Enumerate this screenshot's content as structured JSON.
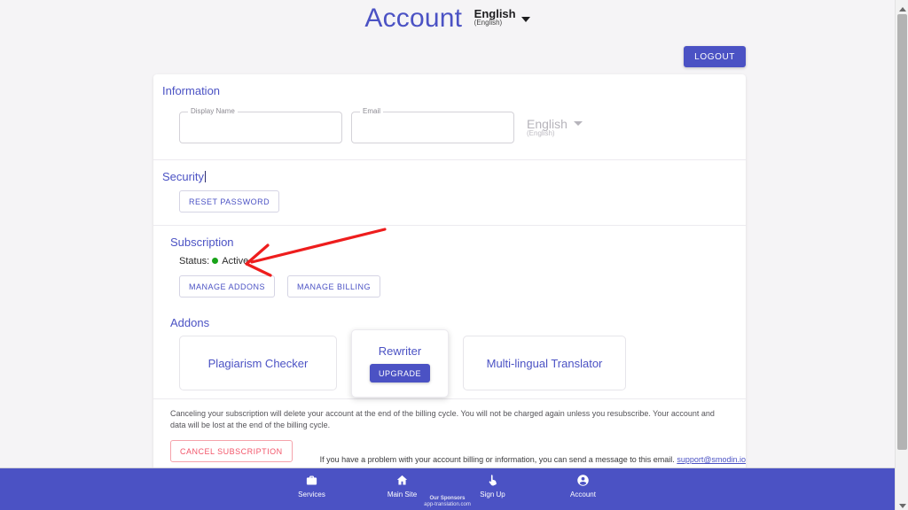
{
  "header": {
    "title": "Account",
    "language": {
      "name": "English",
      "native": "(English)"
    },
    "logout_label": "LOGOUT"
  },
  "information": {
    "section_title": "Information",
    "display_name": {
      "label": "Display Name",
      "value": ""
    },
    "email": {
      "label": "Email",
      "value": ""
    },
    "language": {
      "name": "English",
      "native": "(English)"
    }
  },
  "security": {
    "section_title": "Security",
    "reset_password_label": "RESET PASSWORD"
  },
  "subscription": {
    "section_title": "Subscription",
    "status_label": "Status:",
    "status_value": "Active",
    "status_color": "#19a319",
    "manage_addons_label": "MANAGE ADDONS",
    "manage_billing_label": "MANAGE BILLING"
  },
  "addons": {
    "section_title": "Addons",
    "items": [
      {
        "name": "Plagiarism Checker",
        "action": null
      },
      {
        "name": "Rewriter",
        "action": "UPGRADE"
      },
      {
        "name": "Multi-lingual Translator",
        "action": null
      }
    ]
  },
  "cancel": {
    "notice": "Canceling your subscription will delete your account at the end of the billing cycle. You will not be charged again unless you resubscribe. Your account and data will be lost at the end of the billing cycle.",
    "button_label": "CANCEL SUBSCRIPTION"
  },
  "support": {
    "text": "If you have a problem with your account billing or information, you can send a message to this email.",
    "email": "support@smodin.io"
  },
  "bottom_nav": {
    "items": [
      {
        "label": "Services",
        "icon": "briefcase-icon"
      },
      {
        "label": "Main Site",
        "icon": "home-icon"
      },
      {
        "label": "Sign Up",
        "icon": "touch-icon"
      },
      {
        "label": "Account",
        "icon": "account-circle-icon"
      }
    ],
    "sponsor_title": "Our Sponsors",
    "sponsor_name": "app-translation.com"
  },
  "theme": {
    "primary": "#4b52c4",
    "danger": "#f2566a",
    "page_bg": "#f5f4f6",
    "annotation": "#ee1d1d"
  }
}
